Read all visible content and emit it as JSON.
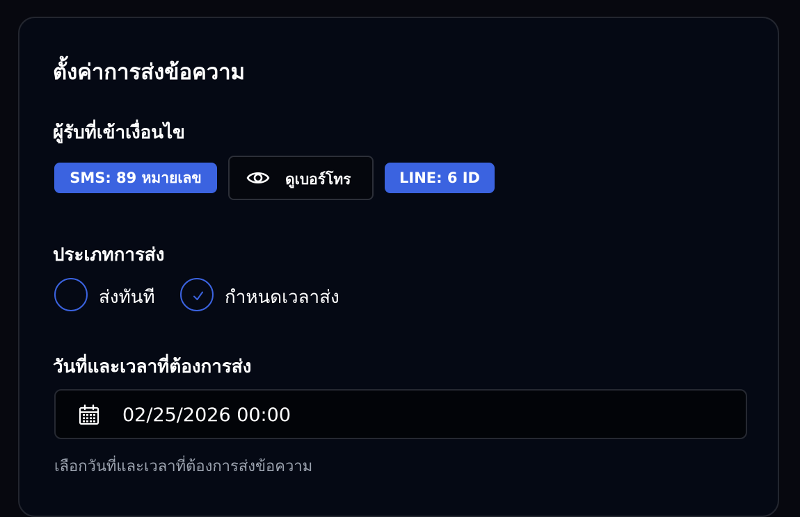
{
  "form": {
    "title": "ตั้งค่าการส่งข้อความ",
    "recipients": {
      "label": "ผู้รับที่เข้าเงื่อนไข",
      "sms_badge": "SMS: 89 หมายเลข",
      "view_button": "ดูเบอร์โทร",
      "line_badge": "LINE: 6 ID"
    },
    "send_type": {
      "label": "ประเภทการส่ง",
      "options": [
        {
          "label": "ส่งทันที",
          "selected": false
        },
        {
          "label": "กำหนดเวลาส่ง",
          "selected": true
        }
      ]
    },
    "schedule": {
      "label": "วันที่และเวลาที่ต้องการส่ง",
      "value": "02/25/2026 00:00",
      "helper": "เลือกวันที่และเวลาที่ต้องการส่งข้อความ"
    }
  },
  "icons": {
    "view": "eye-icon",
    "selected_radio": "check-icon",
    "date": "calendar-icon"
  },
  "colors": {
    "accent": "#3b63e0",
    "background": "#050914",
    "text": "#ffffff",
    "muted": "#9ca3af"
  }
}
